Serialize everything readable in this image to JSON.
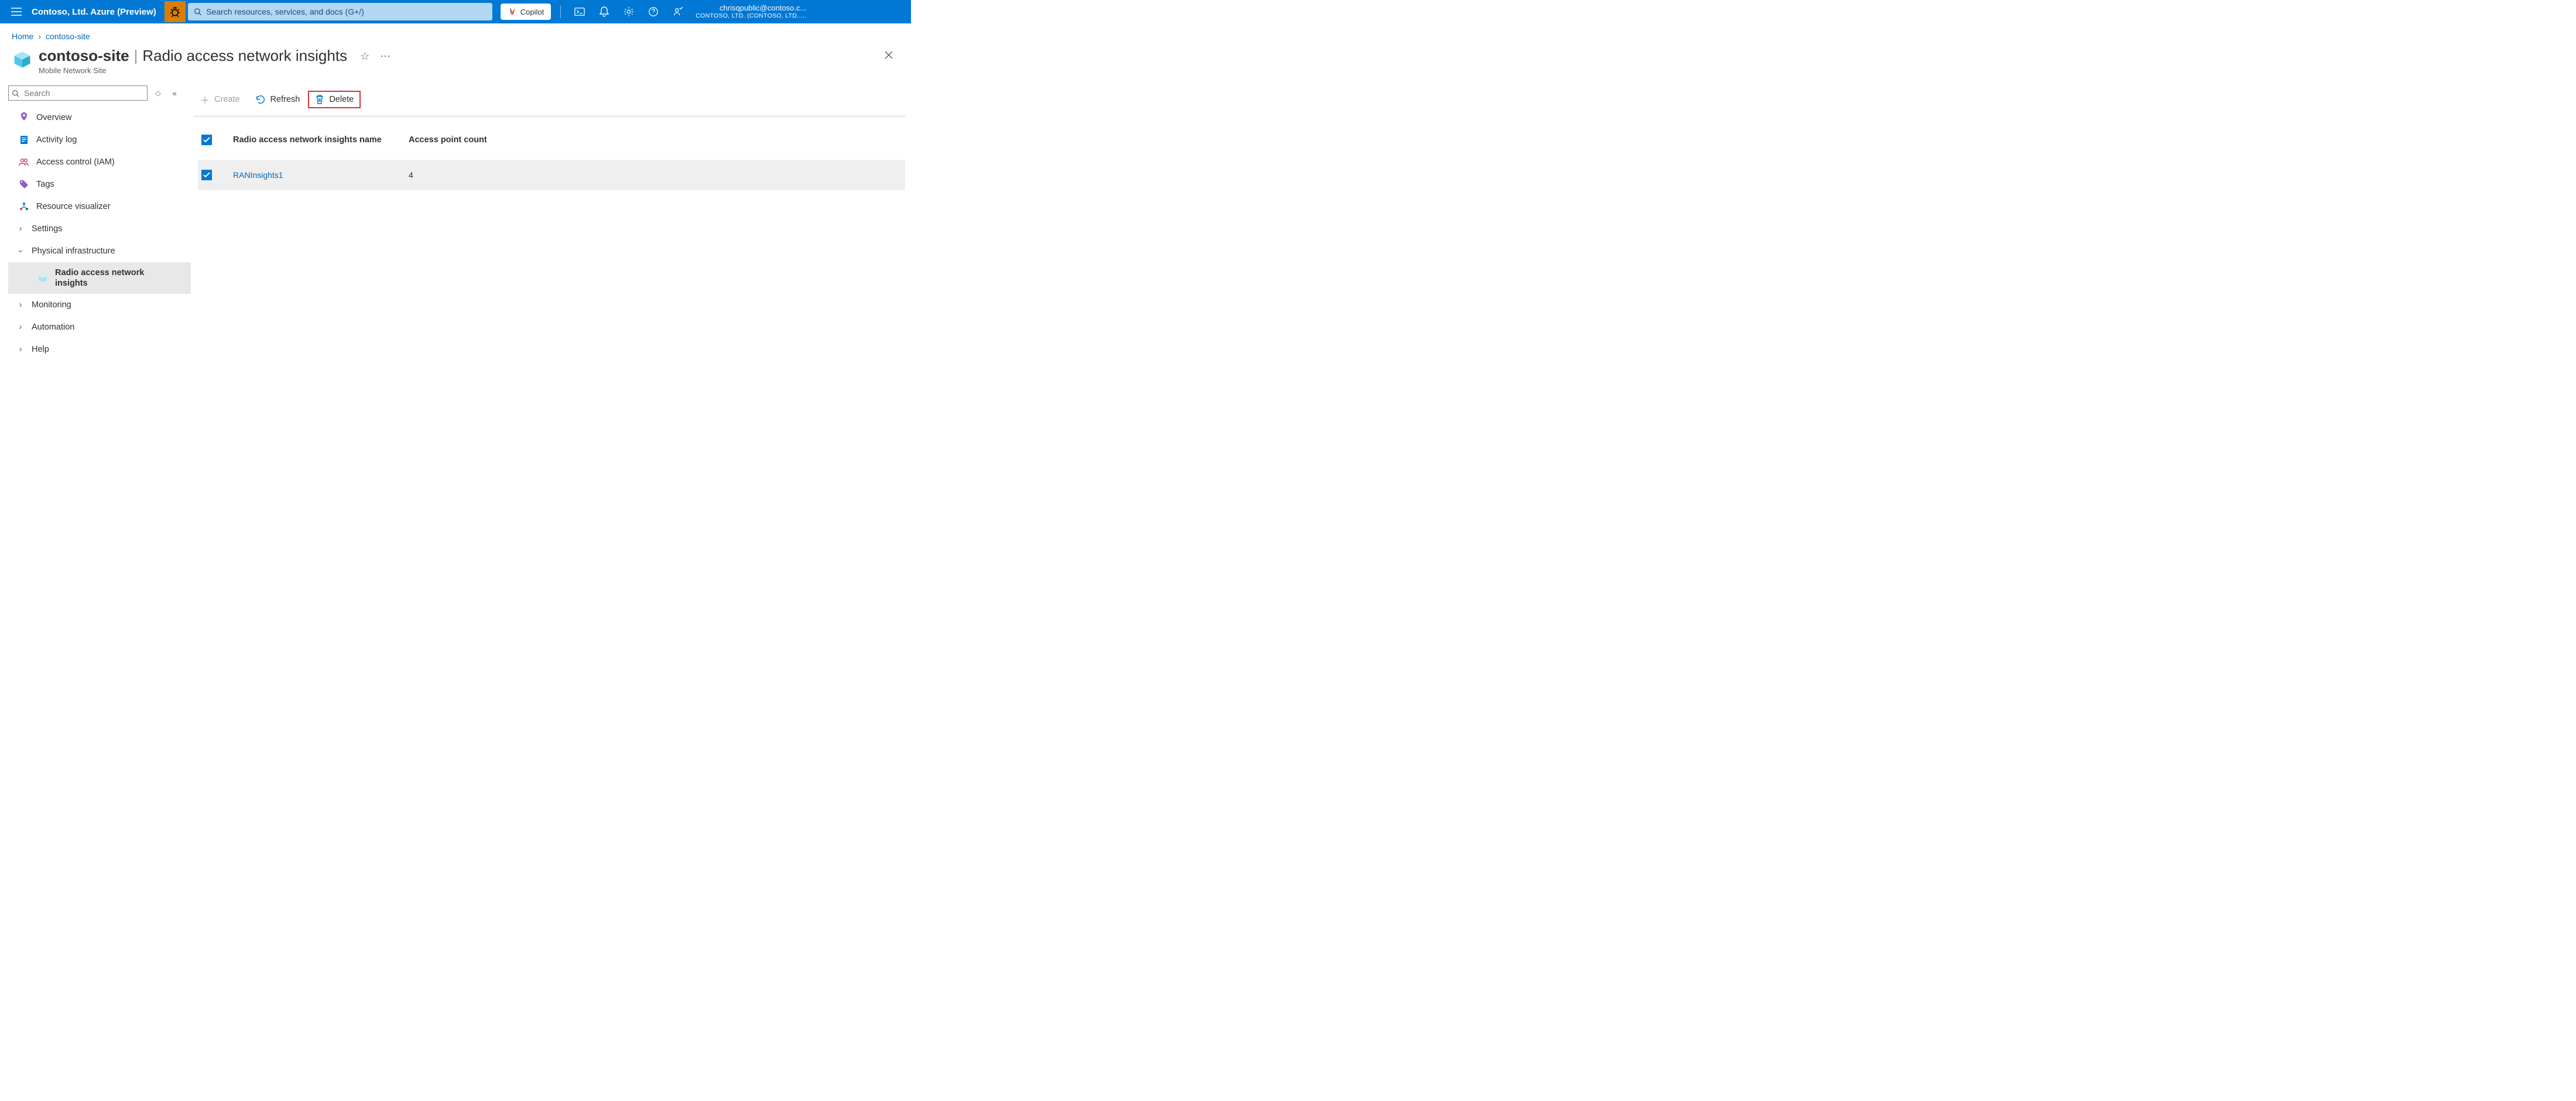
{
  "topbar": {
    "portal_name": "Contoso, Ltd. Azure (Preview)",
    "search_placeholder": "Search resources, services, and docs (G+/)",
    "copilot_label": "Copilot",
    "account_email": "chrisqpublic@contoso.c...",
    "account_dir": "CONTOSO, LTD. (CONTOSO, LTD....."
  },
  "breadcrumb": {
    "home": "Home",
    "current": "contoso-site"
  },
  "title": {
    "resource": "contoso-site",
    "section": "Radio access network insights",
    "resource_type": "Mobile Network Site"
  },
  "sidebar": {
    "search_placeholder": "Search",
    "items": [
      {
        "label": "Overview"
      },
      {
        "label": "Activity log"
      },
      {
        "label": "Access control (IAM)"
      },
      {
        "label": "Tags"
      },
      {
        "label": "Resource visualizer"
      },
      {
        "label": "Settings"
      },
      {
        "label": "Physical infrastructure"
      },
      {
        "label": "Radio access network insights"
      },
      {
        "label": "Monitoring"
      },
      {
        "label": "Automation"
      },
      {
        "label": "Help"
      }
    ]
  },
  "toolbar": {
    "create": "Create",
    "refresh": "Refresh",
    "delete": "Delete"
  },
  "table": {
    "col_name": "Radio access network insights name",
    "col_count": "Access point count",
    "rows": [
      {
        "name": "RANInsights1",
        "count": "4"
      }
    ]
  }
}
